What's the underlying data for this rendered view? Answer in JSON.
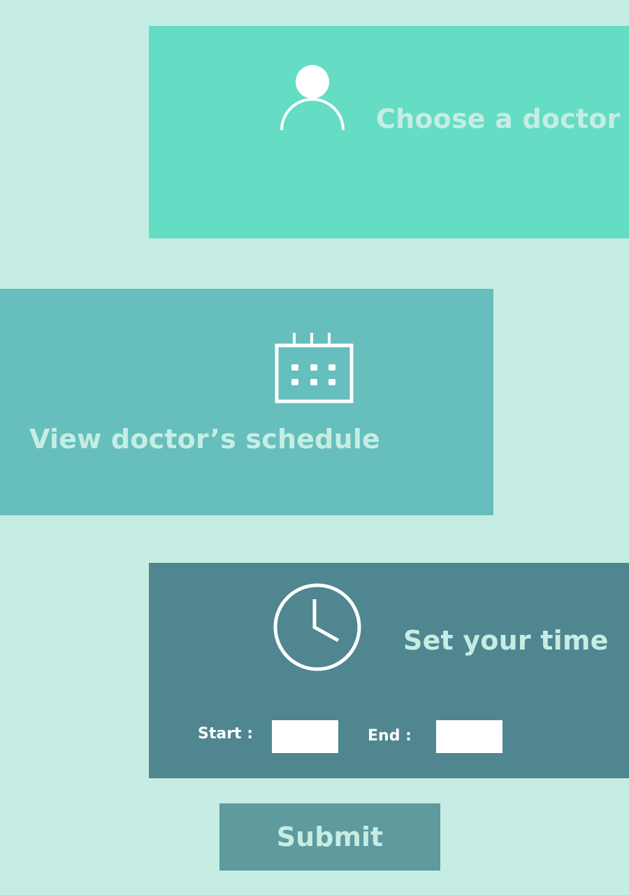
{
  "steps": {
    "choose_doctor": {
      "title": "Choose a doctor",
      "icon": "person-icon",
      "background": "#65dcc4"
    },
    "view_schedule": {
      "title": "View doctor’s schedule",
      "icon": "calendar-icon",
      "background": "#66bfbc"
    },
    "set_time": {
      "title": "Set your time",
      "icon": "clock-icon",
      "background": "#4f8690",
      "start_label": "Start :",
      "start_value": "",
      "end_label": "End :",
      "end_value": ""
    }
  },
  "submit": {
    "label": "Submit"
  },
  "colors": {
    "page_background": "#c6ede3",
    "title_text": "#c6ede3",
    "submit_background": "#5e9a9e"
  }
}
